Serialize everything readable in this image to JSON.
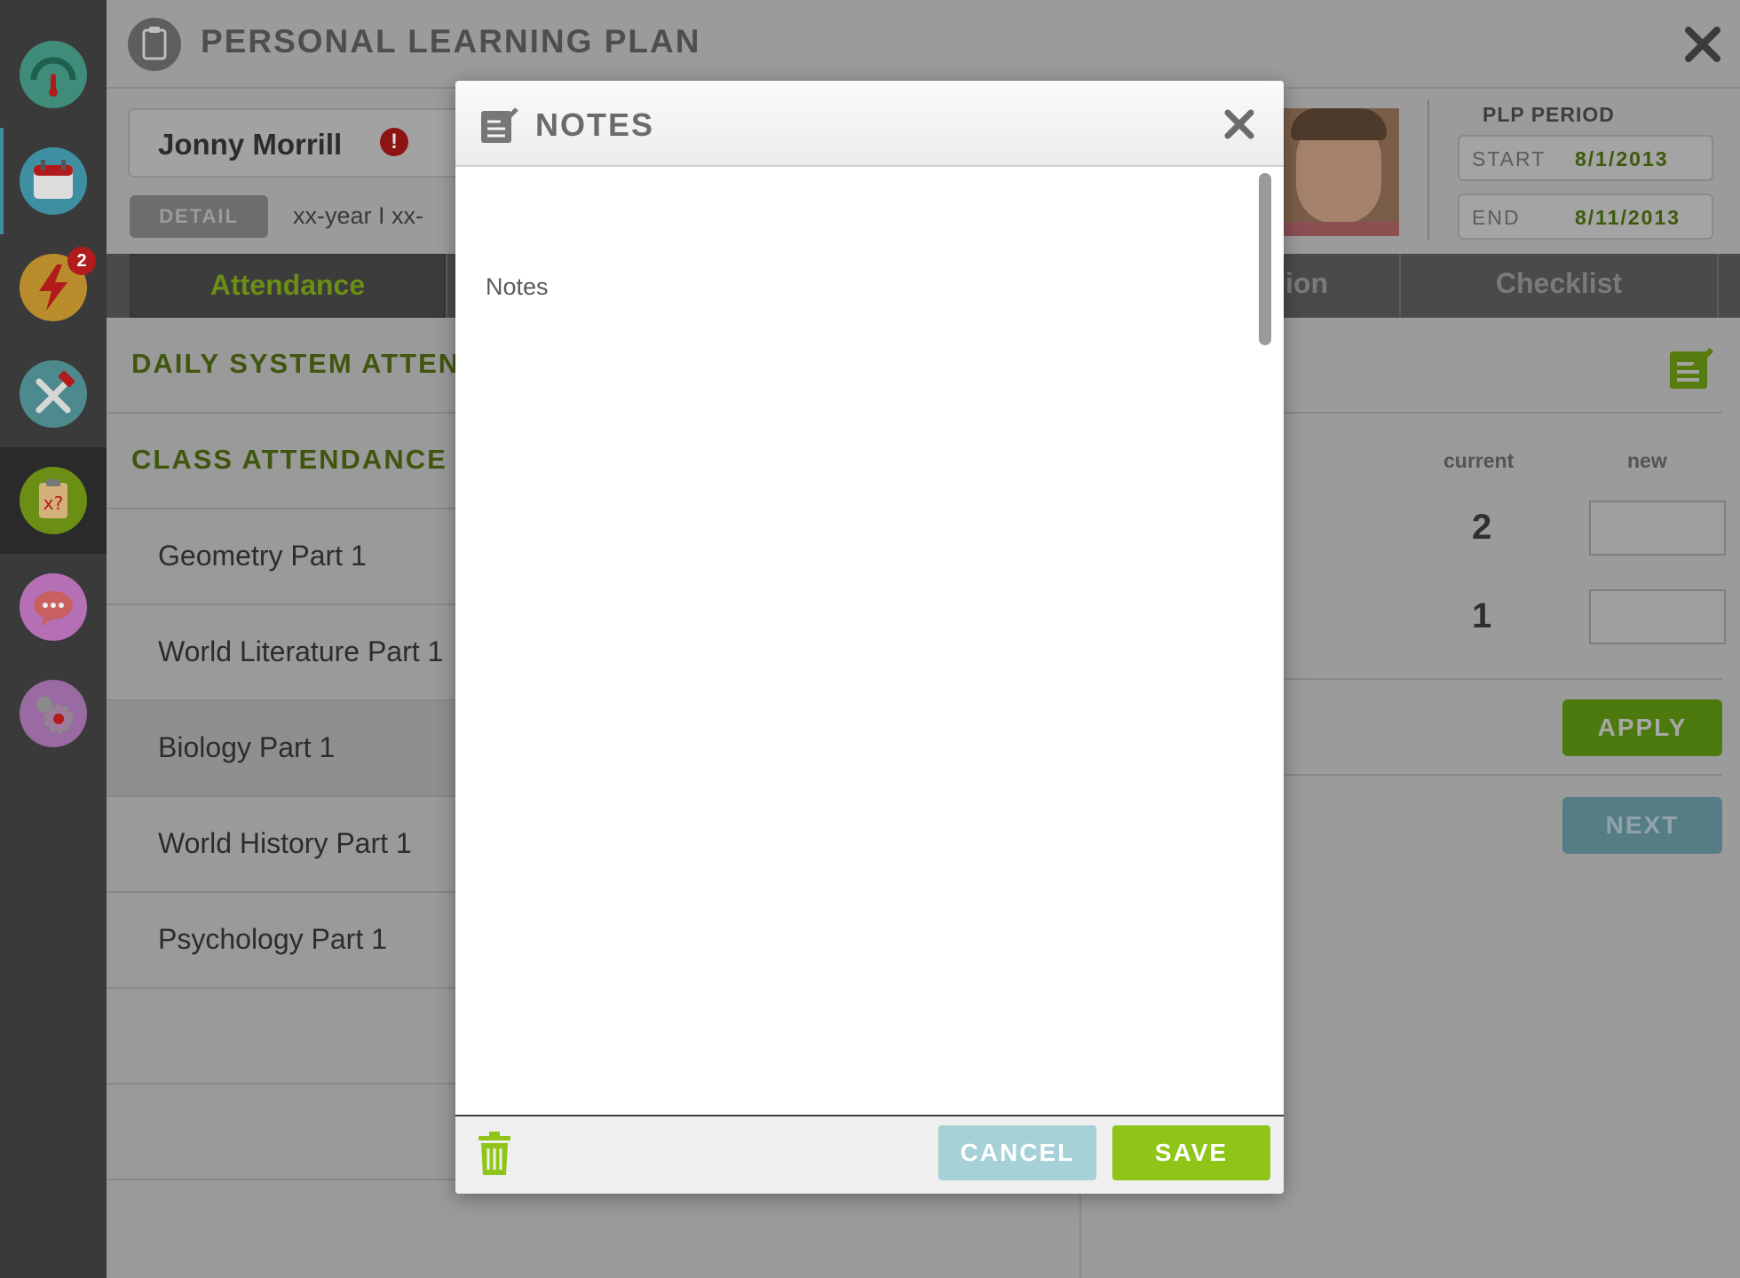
{
  "app": {
    "title": "PERSONAL LEARNING PLAN",
    "accent_color": "#8fc418",
    "nav": [
      {
        "icon": "gauge-icon",
        "color": "#3f8c7a"
      },
      {
        "icon": "calendar-icon",
        "color": "#3f8fa3"
      },
      {
        "icon": "lightning-icon",
        "color": "#b98d2c",
        "badge": "2"
      },
      {
        "icon": "tools-icon",
        "color": "#4d8a8e"
      },
      {
        "icon": "clipboard-icon",
        "color": "#6b8e14"
      },
      {
        "icon": "chat-icon",
        "color": "#b56fb4"
      },
      {
        "icon": "settings-icon",
        "color": "#9a6aa2"
      }
    ]
  },
  "student": {
    "name": "Jonny Morrill",
    "detail_label": "DETAIL",
    "meta": "xx-year  I  xx-"
  },
  "plp_period": {
    "title": "PLP PERIOD",
    "start_label": "START",
    "start_value": "8/1/2013",
    "end_label": "END",
    "end_value": "8/11/2013"
  },
  "tabs": {
    "attendance": "Attendance",
    "partial": "ion",
    "checklist": "Checklist"
  },
  "attendance": {
    "daily_title": "DAILY SYSTEM ATTEN",
    "class_title": "CLASS ATTENDANCE",
    "classes": [
      "Geometry Part 1",
      "World Literature Part 1",
      "Biology Part 1",
      "World History Part 1",
      "Psychology Part 1"
    ],
    "col_current": "current",
    "col_new": "new",
    "current_values": [
      "2",
      "1"
    ],
    "apply_label": "APPLY",
    "next_label": "NEXT"
  },
  "modal": {
    "title": "NOTES",
    "placeholder": "Notes",
    "cancel_label": "CANCEL",
    "save_label": "SAVE"
  }
}
